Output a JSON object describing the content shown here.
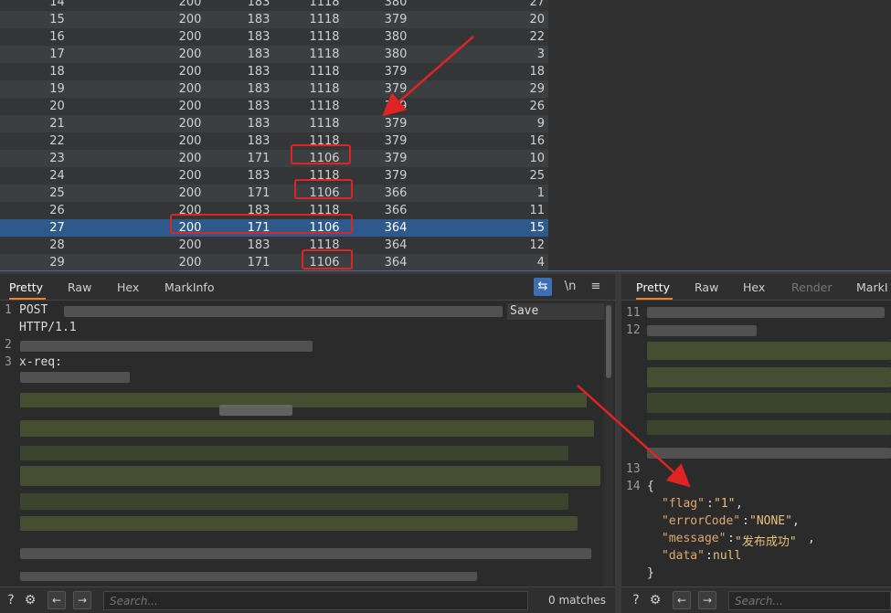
{
  "results_table": {
    "rows": [
      {
        "id": "14",
        "status": "200",
        "error": "183",
        "length": "1118",
        "time": "380",
        "rt": "27"
      },
      {
        "id": "15",
        "status": "200",
        "error": "183",
        "length": "1118",
        "time": "379",
        "rt": "20"
      },
      {
        "id": "16",
        "status": "200",
        "error": "183",
        "length": "1118",
        "time": "380",
        "rt": "22"
      },
      {
        "id": "17",
        "status": "200",
        "error": "183",
        "length": "1118",
        "time": "380",
        "rt": "3"
      },
      {
        "id": "18",
        "status": "200",
        "error": "183",
        "length": "1118",
        "time": "379",
        "rt": "18"
      },
      {
        "id": "19",
        "status": "200",
        "error": "183",
        "length": "1118",
        "time": "379",
        "rt": "29"
      },
      {
        "id": "20",
        "status": "200",
        "error": "183",
        "length": "1118",
        "time": "379",
        "rt": "26"
      },
      {
        "id": "21",
        "status": "200",
        "error": "183",
        "length": "1118",
        "time": "379",
        "rt": "9"
      },
      {
        "id": "22",
        "status": "200",
        "error": "183",
        "length": "1118",
        "time": "379",
        "rt": "16"
      },
      {
        "id": "23",
        "status": "200",
        "error": "171",
        "length": "1106",
        "time": "379",
        "rt": "10"
      },
      {
        "id": "24",
        "status": "200",
        "error": "183",
        "length": "1118",
        "time": "379",
        "rt": "25"
      },
      {
        "id": "25",
        "status": "200",
        "error": "171",
        "length": "1106",
        "time": "366",
        "rt": "1"
      },
      {
        "id": "26",
        "status": "200",
        "error": "183",
        "length": "1118",
        "time": "366",
        "rt": "11"
      },
      {
        "id": "27",
        "status": "200",
        "error": "171",
        "length": "1106",
        "time": "364",
        "rt": "15"
      },
      {
        "id": "28",
        "status": "200",
        "error": "183",
        "length": "1118",
        "time": "364",
        "rt": "12"
      },
      {
        "id": "29",
        "status": "200",
        "error": "171",
        "length": "1106",
        "time": "364",
        "rt": "4"
      }
    ],
    "selected_row": "27"
  },
  "request_panel": {
    "tabs": [
      "Pretty",
      "Raw",
      "Hex",
      "MarkInfo"
    ],
    "active_tab": "Pretty",
    "toolbar": {
      "newline_label": "\\n",
      "menu_glyph": "≡"
    },
    "lines": [
      {
        "num": "1",
        "text": "POST"
      },
      {
        "num": "",
        "text": "HTTP/1.1"
      },
      {
        "num": "2",
        "text": ""
      },
      {
        "num": "3",
        "text": "x-req:"
      }
    ],
    "save_label": "Save",
    "search_placeholder": "Search...",
    "matches": "0 matches"
  },
  "response_panel": {
    "tabs": [
      "Pretty",
      "Raw",
      "Hex",
      "Render",
      "MarkI"
    ],
    "active_tab": "Pretty",
    "line_numbers": [
      "11",
      "12",
      "13",
      "14"
    ],
    "json": {
      "open": "{",
      "flag_key": "\"flag\"",
      "flag_val": "\"1\"",
      "errorCode_key": "\"errorCode\"",
      "errorCode_val": "\"NONE\"",
      "message_key": "\"message\"",
      "message_val": "\"发布成功\"",
      "data_key": "\"data\"",
      "data_val": "null",
      "close": "}"
    },
    "search_placeholder": "Search..."
  },
  "icons": {
    "help": "help-icon",
    "settings": "gear-icon",
    "back": "arrow-left-icon",
    "forward": "arrow-right-icon",
    "wrap": "wrap-icon"
  },
  "colors": {
    "highlight_box": "#e02424",
    "selected_row": "#2d5a8a",
    "active_tab_underline": "#e8833a"
  }
}
